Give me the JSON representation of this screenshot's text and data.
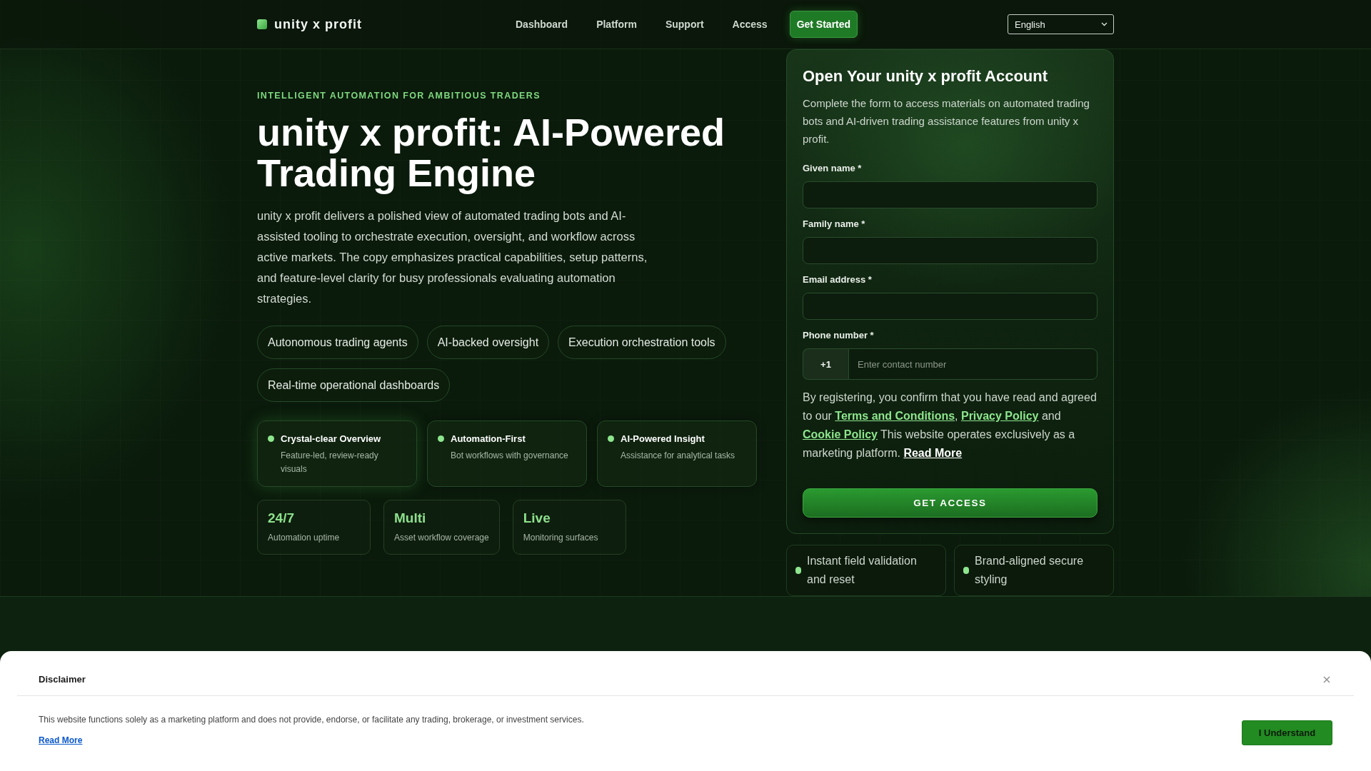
{
  "header": {
    "logo": "unity x profit",
    "nav": [
      {
        "label": "Dashboard"
      },
      {
        "label": "Platform"
      },
      {
        "label": "Support"
      },
      {
        "label": "Access"
      }
    ],
    "cta": "Get Started",
    "language": "English"
  },
  "hero": {
    "eyebrow": "INTELLIGENT AUTOMATION FOR AMBITIOUS TRADERS",
    "title": "unity x profit: AI-Powered Trading Engine",
    "description": "unity x profit delivers a polished view of automated trading bots and AI-assisted tooling to orchestrate execution, oversight, and workflow across active markets. The copy emphasizes practical capabilities, setup patterns, and feature-level clarity for busy professionals evaluating automation strategies.",
    "tags": [
      "Autonomous trading agents",
      "AI-backed oversight",
      "Execution orchestration tools",
      "Real-time operational dashboards"
    ],
    "features": [
      {
        "title": "Crystal-clear Overview",
        "text": "Feature-led, review-ready visuals"
      },
      {
        "title": "Automation-First",
        "text": "Bot workflows with governance"
      },
      {
        "title": "AI-Powered Insight",
        "text": "Assistance for analytical tasks"
      }
    ],
    "stats": [
      {
        "value": "24/7",
        "label": "Automation uptime"
      },
      {
        "value": "Multi",
        "label": "Asset workflow coverage"
      },
      {
        "value": "Live",
        "label": "Monitoring surfaces"
      }
    ]
  },
  "form": {
    "title": "Open Your unity x profit Account",
    "description": "Complete the form to access materials on automated trading bots and AI-driven trading assistance features from unity x profit.",
    "fields": [
      {
        "kind": "text",
        "label": "Given name *"
      },
      {
        "kind": "text",
        "label": "Family name *"
      },
      {
        "kind": "email",
        "label": "Email address *"
      },
      {
        "kind": "phone",
        "label": "Phone number *",
        "prefix": "+1",
        "placeholder": "Enter contact number"
      }
    ],
    "consent": [
      {
        "kind": "text",
        "text": "By registering, you confirm that you have read and agreed to our "
      },
      {
        "kind": "link",
        "text": "Terms and Conditions"
      },
      {
        "kind": "text",
        "text": ", "
      },
      {
        "kind": "link",
        "text": "Privacy Policy"
      },
      {
        "kind": "text",
        "text": " and "
      },
      {
        "kind": "link",
        "text": "Cookie Policy"
      },
      {
        "kind": "text",
        "text": " This website operates exclusively as a marketing platform. "
      },
      {
        "kind": "more",
        "text": "Read More"
      }
    ],
    "submit": "GET ACCESS"
  },
  "form_notes": [
    "Instant field validation and reset",
    "Brand-aligned secure styling"
  ],
  "disclaimer": {
    "title": "Disclaimer",
    "text": "This website functions solely as a marketing platform and does not provide, endorse, or facilitate any trading, brokerage, or investment services.",
    "link": "Read More",
    "button": "I Understand"
  }
}
